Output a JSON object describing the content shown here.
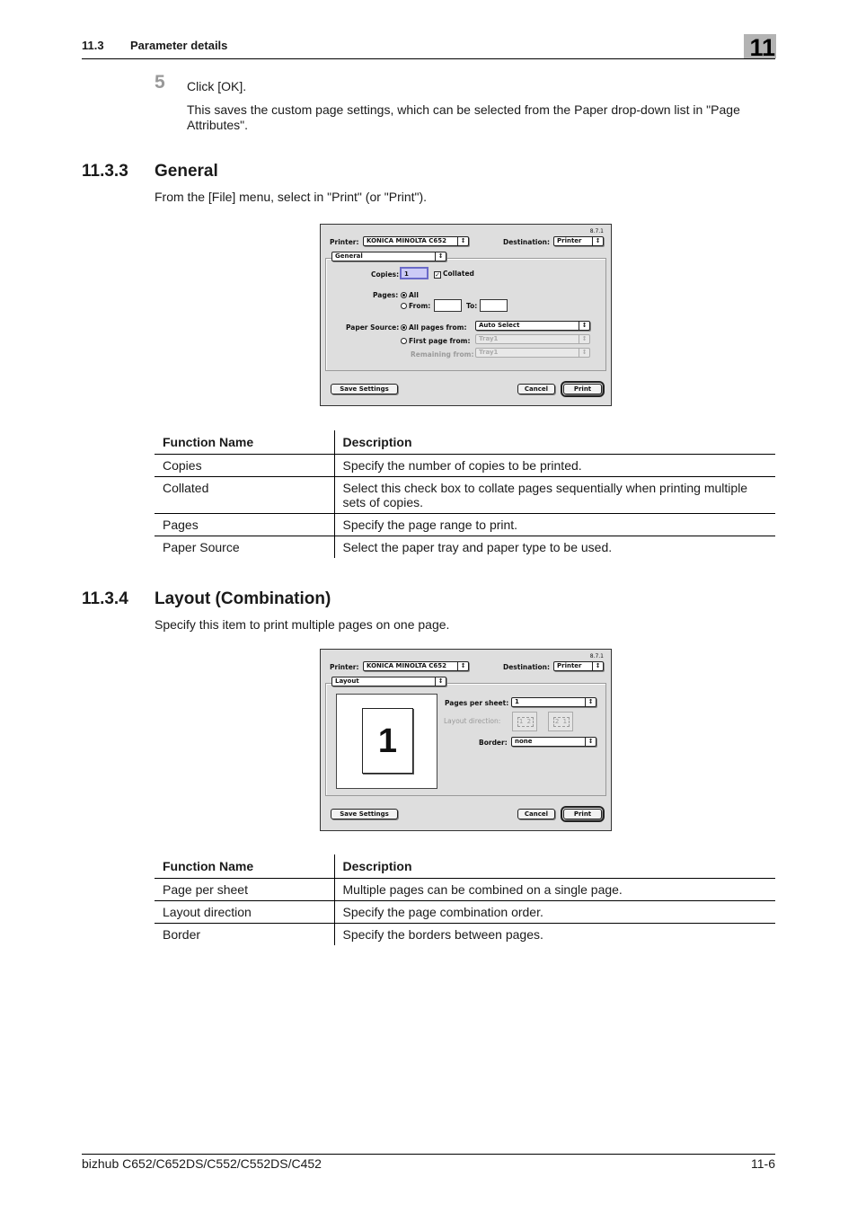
{
  "header": {
    "section_number": "11.3",
    "section_title": "Parameter details",
    "chapter_badge": "11"
  },
  "step": {
    "number": "5",
    "instruction": "Click [OK].",
    "note": "This saves the custom page settings, which can be selected from the Paper drop-down list in \"Page Attributes\"."
  },
  "general_section": {
    "number": "11.3.3",
    "title": "General",
    "intro": "From the [File] menu, select in \"Print\" (or \"Print\").",
    "dialog": {
      "version": "8.7.1",
      "printer_label": "Printer:",
      "printer_value": "KONICA MINOLTA C652",
      "destination_label": "Destination:",
      "destination_value": "Printer",
      "panel_value": "General",
      "copies_label": "Copies:",
      "copies_value": "1",
      "collated_label": "Collated",
      "collated_checked": true,
      "pages_label": "Pages:",
      "pages_all_label": "All",
      "pages_from_label": "From:",
      "pages_from_value": "",
      "pages_to_label": "To:",
      "pages_to_value": "",
      "pages_selected": "All",
      "paper_source_label": "Paper Source:",
      "all_pages_from_label": "All pages from:",
      "all_pages_from_value": "Auto Select",
      "first_page_from_label": "First page from:",
      "first_page_from_value": "Tray1",
      "remaining_from_label": "Remaining from:",
      "remaining_from_value": "Tray1",
      "paper_source_selected": "All pages from",
      "save_settings_label": "Save Settings",
      "cancel_label": "Cancel",
      "print_label": "Print"
    },
    "table": {
      "headers": [
        "Function Name",
        "Description"
      ],
      "rows": [
        [
          "Copies",
          "Specify the number of copies to be printed."
        ],
        [
          "Collated",
          "Select this check box to collate pages sequentially when printing multiple sets of copies."
        ],
        [
          "Pages",
          "Specify the page range to print."
        ],
        [
          "Paper Source",
          "Select the paper tray and paper type to be used."
        ]
      ]
    }
  },
  "layout_section": {
    "number": "11.3.4",
    "title": "Layout (Combination)",
    "intro": "Specify this item to print multiple pages on one page.",
    "dialog": {
      "version": "8.7.1",
      "printer_label": "Printer:",
      "printer_value": "KONICA MINOLTA C652",
      "destination_label": "Destination:",
      "destination_value": "Printer",
      "panel_value": "Layout",
      "preview_page_number": "1",
      "pages_per_sheet_label": "Pages per sheet:",
      "pages_per_sheet_value": "1",
      "layout_direction_label": "Layout direction:",
      "layout_direction_options": [
        "1 2",
        "2 1"
      ],
      "border_label": "Border:",
      "border_value": "none",
      "save_settings_label": "Save Settings",
      "cancel_label": "Cancel",
      "print_label": "Print"
    },
    "table": {
      "headers": [
        "Function Name",
        "Description"
      ],
      "rows": [
        [
          "Page per sheet",
          "Multiple pages can be combined on a single page."
        ],
        [
          "Layout direction",
          "Specify the page combination order."
        ],
        [
          "Border",
          "Specify the borders between pages."
        ]
      ]
    }
  },
  "footer": {
    "product": "bizhub C652/C652DS/C552/C552DS/C452",
    "page": "11-6"
  }
}
